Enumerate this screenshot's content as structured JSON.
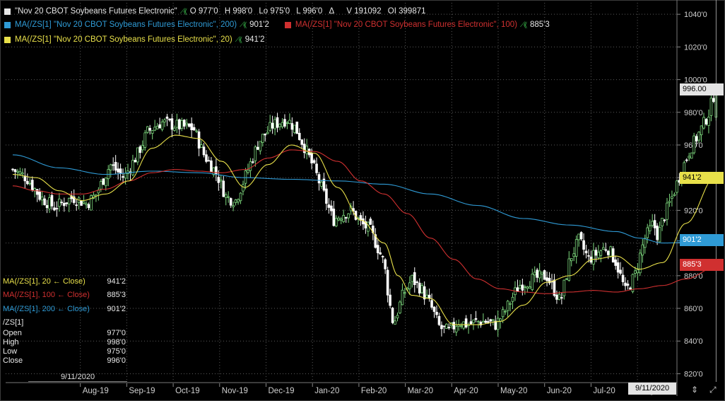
{
  "legend": {
    "main": {
      "name": "\"Nov 20 CBOT Soybeans Futures Electronic\"",
      "open": "O 977'0",
      "high": "H 998'0",
      "low": "Lo 975'0",
      "last": "L 996'0",
      "delta": "Δ",
      "volume": "V 191092",
      "oi": "OI 399871"
    },
    "ma200": {
      "label": "MA(/ZS[1] \"Nov 20 CBOT Soybeans Futures Electronic\", 200)",
      "value": "901'2"
    },
    "ma100": {
      "label": "MA(/ZS[1] \"Nov 20 CBOT Soybeans Futures Electronic\", 100)",
      "value": "885'3"
    },
    "ma20": {
      "label": "MA(/ZS[1] \"Nov 20 CBOT Soybeans Futures Electronic\", 20)",
      "value": "941'2"
    }
  },
  "databox": {
    "rows": [
      {
        "label": "MA(/ZS[1], 20 ← Close)",
        "value": "941'2",
        "color": "#e8e04a"
      },
      {
        "label": "MA(/ZS[1], 100 ← Close)",
        "value": "885'3",
        "color": "#d03030"
      },
      {
        "label": "MA(/ZS[1], 200 ← Close)",
        "value": "901'2",
        "color": "#2f9bd6"
      }
    ],
    "symbol": "/ZS[1]",
    "ohlc": [
      {
        "label": "Open",
        "value": "977'0"
      },
      {
        "label": "High",
        "value": "998'0"
      },
      {
        "label": "Low",
        "value": "975'0"
      },
      {
        "label": "Close",
        "value": "996'0"
      }
    ],
    "date": "9/11/2020"
  },
  "price_boxes": {
    "last": "996.00",
    "ma20": "941'2",
    "ma200": "901'2",
    "ma100": "885'3"
  },
  "bottom_date": "9/11/2020",
  "colors": {
    "up": "#7ed97e",
    "down": "#ffffff",
    "ma20": "#e8e04a",
    "ma100": "#d03030",
    "ma200": "#2f9bd6",
    "grid": "#5a5a5a",
    "cursor": "#bbbbbb"
  },
  "chart_data": {
    "type": "candlestick",
    "title": "\"Nov 20 CBOT Soybeans Futures Electronic\"",
    "xlabel": "",
    "ylabel": "",
    "ylim": [
      815,
      1047
    ],
    "grid": true,
    "y_ticks": [
      {
        "v": 1040,
        "label": "1040'0"
      },
      {
        "v": 1020,
        "label": "1020'0"
      },
      {
        "v": 1000,
        "label": "1000'0"
      },
      {
        "v": 980,
        "label": "980'0"
      },
      {
        "v": 960,
        "label": "960'0"
      },
      {
        "v": 940,
        "label": "940'0"
      },
      {
        "v": 920,
        "label": "920'0"
      },
      {
        "v": 900,
        "label": "900'0"
      },
      {
        "v": 880,
        "label": "880'0"
      },
      {
        "v": 860,
        "label": "860'0"
      },
      {
        "v": 840,
        "label": "840'0"
      },
      {
        "v": 820,
        "label": "820'0"
      }
    ],
    "x_ticks": [
      {
        "label": "Aug-19",
        "month": 1.0
      },
      {
        "label": "Sep-19",
        "month": 2.0
      },
      {
        "label": "Oct-19",
        "month": 3.0
      },
      {
        "label": "Nov-19",
        "month": 4.0
      },
      {
        "label": "Dec-19",
        "month": 5.0
      },
      {
        "label": "Jan-20",
        "month": 6.0
      },
      {
        "label": "Feb-20",
        "month": 7.0
      },
      {
        "label": "Mar-20",
        "month": 8.0
      },
      {
        "label": "Apr-20",
        "month": 9.0
      },
      {
        "label": "May-20",
        "month": 10.0
      },
      {
        "label": "Jun-20",
        "month": 11.0
      },
      {
        "label": "Jul-20",
        "month": 12.0
      },
      {
        "label": "Aug-20",
        "month": 13.0
      }
    ],
    "close_anchors": [
      [
        0.0,
        945
      ],
      [
        0.3,
        940
      ],
      [
        0.6,
        928
      ],
      [
        0.9,
        922
      ],
      [
        1.3,
        928
      ],
      [
        1.6,
        924
      ],
      [
        1.8,
        930
      ],
      [
        2.1,
        948
      ],
      [
        2.4,
        940
      ],
      [
        2.7,
        955
      ],
      [
        2.9,
        968
      ],
      [
        3.2,
        974
      ],
      [
        3.5,
        972
      ],
      [
        3.9,
        970
      ],
      [
        4.1,
        955
      ],
      [
        4.4,
        942
      ],
      [
        4.6,
        928
      ],
      [
        4.8,
        926
      ],
      [
        5.0,
        940
      ],
      [
        5.3,
        962
      ],
      [
        5.6,
        972
      ],
      [
        5.9,
        976
      ],
      [
        6.1,
        970
      ],
      [
        6.3,
        958
      ],
      [
        6.5,
        945
      ],
      [
        6.7,
        930
      ],
      [
        6.9,
        914
      ],
      [
        7.1,
        918
      ],
      [
        7.3,
        920
      ],
      [
        7.5,
        912
      ],
      [
        7.7,
        908
      ],
      [
        8.0,
        888
      ],
      [
        8.1,
        866
      ],
      [
        8.2,
        850
      ],
      [
        8.4,
        868
      ],
      [
        8.6,
        878
      ],
      [
        8.8,
        872
      ],
      [
        9.0,
        862
      ],
      [
        9.2,
        848
      ],
      [
        9.4,
        846
      ],
      [
        9.6,
        852
      ],
      [
        9.8,
        850
      ],
      [
        10.0,
        852
      ],
      [
        10.2,
        852
      ],
      [
        10.4,
        850
      ],
      [
        10.6,
        858
      ],
      [
        10.9,
        874
      ],
      [
        11.2,
        878
      ],
      [
        11.5,
        880
      ],
      [
        11.8,
        864
      ],
      [
        12.0,
        890
      ],
      [
        12.2,
        902
      ],
      [
        12.4,
        890
      ],
      [
        12.6,
        894
      ],
      [
        12.8,
        898
      ],
      [
        13.0,
        888
      ],
      [
        13.2,
        870
      ],
      [
        13.4,
        880
      ],
      [
        13.6,
        902
      ],
      [
        13.8,
        912
      ],
      [
        13.9,
        904
      ],
      [
        14.0,
        914
      ],
      [
        14.2,
        928
      ],
      [
        14.4,
        944
      ],
      [
        14.6,
        958
      ],
      [
        14.8,
        968
      ],
      [
        15.0,
        980
      ],
      [
        15.15,
        996
      ]
    ],
    "series": [
      {
        "name": "MA(/ZS[1] \"Nov 20 CBOT Soybeans Futures Electronic\", 200)",
        "last": "901'2",
        "points": [
          [
            0.0,
            954
          ],
          [
            1.0,
            946
          ],
          [
            2.0,
            942
          ],
          [
            3.0,
            944
          ],
          [
            4.0,
            943
          ],
          [
            5.0,
            940
          ],
          [
            6.0,
            939
          ],
          [
            7.0,
            938
          ],
          [
            8.0,
            936
          ],
          [
            9.0,
            930
          ],
          [
            10.0,
            923
          ],
          [
            11.0,
            915
          ],
          [
            12.0,
            911
          ],
          [
            13.0,
            907
          ],
          [
            13.5,
            903
          ],
          [
            14.0,
            900
          ],
          [
            15.15,
            901.3
          ]
        ]
      },
      {
        "name": "MA(/ZS[1] \"Nov 20 CBOT Soybeans Futures Electronic\", 100)",
        "last": "885'3",
        "points": [
          [
            0.0,
            935
          ],
          [
            0.5,
            932
          ],
          [
            1.0,
            930
          ],
          [
            1.5,
            930
          ],
          [
            2.0,
            933
          ],
          [
            2.5,
            938
          ],
          [
            3.0,
            943
          ],
          [
            3.5,
            945
          ],
          [
            4.0,
            944
          ],
          [
            4.5,
            943
          ],
          [
            5.0,
            945
          ],
          [
            5.5,
            952
          ],
          [
            6.0,
            957
          ],
          [
            6.5,
            956
          ],
          [
            7.0,
            950
          ],
          [
            7.5,
            938
          ],
          [
            8.0,
            930
          ],
          [
            8.5,
            918
          ],
          [
            9.0,
            903
          ],
          [
            9.5,
            890
          ],
          [
            10.0,
            878
          ],
          [
            10.5,
            872
          ],
          [
            11.0,
            870
          ],
          [
            11.5,
            869
          ],
          [
            12.0,
            870
          ],
          [
            12.5,
            871
          ],
          [
            13.0,
            870
          ],
          [
            13.5,
            872
          ],
          [
            14.0,
            874
          ],
          [
            14.5,
            878
          ],
          [
            15.15,
            885.4
          ]
        ]
      },
      {
        "name": "MA(/ZS[1] \"Nov 20 CBOT Soybeans Futures Electronic\", 20)",
        "last": "941'2",
        "points": [
          [
            0.0,
            942
          ],
          [
            0.5,
            940
          ],
          [
            1.0,
            932
          ],
          [
            1.5,
            926
          ],
          [
            2.0,
            930
          ],
          [
            2.5,
            938
          ],
          [
            3.0,
            958
          ],
          [
            3.5,
            966
          ],
          [
            4.0,
            964
          ],
          [
            4.5,
            950
          ],
          [
            5.0,
            934
          ],
          [
            5.5,
            948
          ],
          [
            6.0,
            960
          ],
          [
            6.5,
            955
          ],
          [
            7.0,
            934
          ],
          [
            7.5,
            914
          ],
          [
            8.0,
            900
          ],
          [
            8.3,
            880
          ],
          [
            8.6,
            868
          ],
          [
            9.0,
            866
          ],
          [
            9.5,
            850
          ],
          [
            10.0,
            850
          ],
          [
            10.5,
            852
          ],
          [
            11.0,
            862
          ],
          [
            11.5,
            876
          ],
          [
            12.0,
            880
          ],
          [
            12.5,
            890
          ],
          [
            13.0,
            892
          ],
          [
            13.5,
            884
          ],
          [
            14.0,
            888
          ],
          [
            14.5,
            912
          ],
          [
            15.15,
            941.3
          ]
        ]
      }
    ],
    "last_close": 996.0
  }
}
